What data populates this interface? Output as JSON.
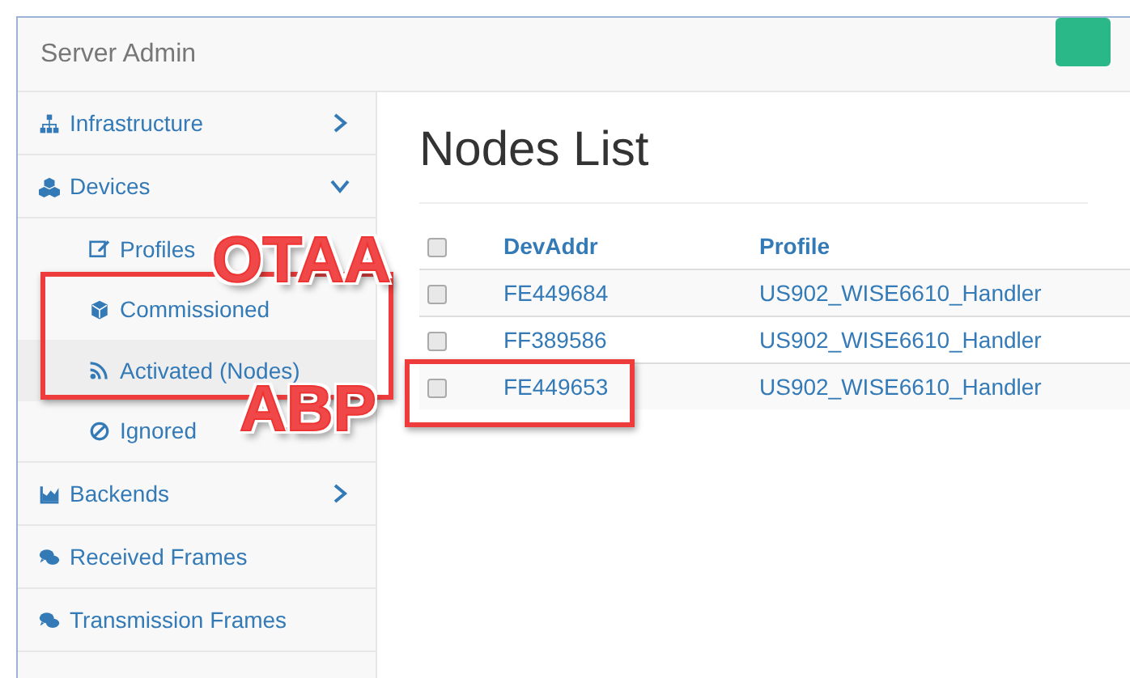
{
  "header": {
    "title": "Server Admin"
  },
  "sidebar": {
    "items": [
      {
        "label": "Infrastructure",
        "expanded": false
      },
      {
        "label": "Devices",
        "expanded": true,
        "children": [
          {
            "label": "Profiles",
            "selected": false
          },
          {
            "label": "Commissioned",
            "selected": false
          },
          {
            "label": "Activated (Nodes)",
            "selected": true
          },
          {
            "label": "Ignored",
            "selected": false
          }
        ]
      },
      {
        "label": "Backends",
        "expanded": false
      },
      {
        "label": "Received Frames"
      },
      {
        "label": "Transmission Frames"
      }
    ]
  },
  "page": {
    "title": "Nodes List"
  },
  "table": {
    "header_checked": false,
    "columns": [
      "DevAddr",
      "Profile"
    ],
    "rows": [
      {
        "checked": false,
        "cells": [
          "FE449684",
          "US902_WISE6610_Handler"
        ]
      },
      {
        "checked": false,
        "cells": [
          "FF389586",
          "US902_WISE6610_Handler"
        ]
      },
      {
        "checked": false,
        "cells": [
          "FE449653",
          "US902_WISE6610_Handler"
        ]
      }
    ]
  },
  "annotations": [
    {
      "text": "OTAA"
    },
    {
      "text": "ABP"
    }
  ]
}
